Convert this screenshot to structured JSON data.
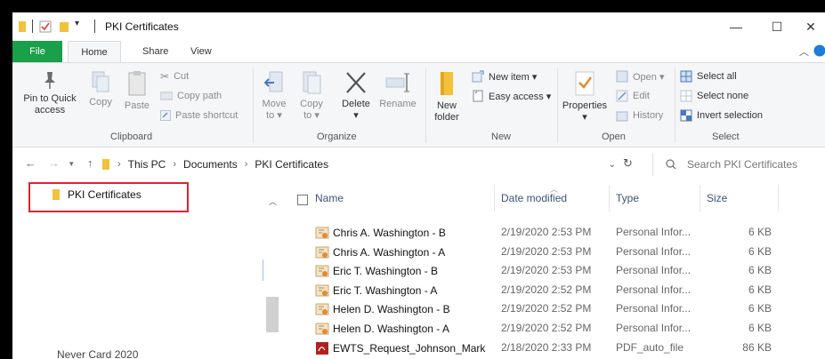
{
  "window": {
    "title": "PKI Certificates",
    "controls": {
      "minimize": "—",
      "maximize": "☐",
      "close": "✕"
    }
  },
  "tabs": [
    {
      "label": "File"
    },
    {
      "label": "Home"
    },
    {
      "label": "Share"
    },
    {
      "label": "View"
    }
  ],
  "ribbon": {
    "clipboard": {
      "pin_label_1": "Pin to Quick",
      "pin_label_2": "access",
      "copy": "Copy",
      "paste": "Paste",
      "cut": "Cut",
      "copy_path": "Copy path",
      "paste_shortcut": "Paste shortcut",
      "group": "Clipboard"
    },
    "organize": {
      "move_to_1": "Move",
      "move_to_2": "to ▾",
      "copy_to_1": "Copy",
      "copy_to_2": "to ▾",
      "delete_1": "Delete",
      "delete_2": "▾",
      "rename": "Rename",
      "group": "Organize"
    },
    "new": {
      "new_folder_1": "New",
      "new_folder_2": "folder",
      "new_item": "New item ▾",
      "easy_access": "Easy access ▾",
      "group": "New"
    },
    "open": {
      "properties_1": "Properties",
      "properties_2": "▾",
      "open": "Open ▾",
      "edit": "Edit",
      "history": "History",
      "group": "Open"
    },
    "select": {
      "select_all": "Select all",
      "select_none": "Select none",
      "invert_selection": "Invert selection",
      "group": "Select"
    }
  },
  "address": {
    "crumbs": [
      "This PC",
      "Documents",
      "PKI Certificates"
    ],
    "search_placeholder": "Search PKI Certificates"
  },
  "nav": {
    "selected_item": "PKI Certificates",
    "bottom_item": "Never Card 2020"
  },
  "columns": {
    "name": "Name",
    "date": "Date modified",
    "type": "Type",
    "size": "Size"
  },
  "files": [
    {
      "name": "Chris A. Washington - B",
      "date": "2/19/2020 2:53 PM",
      "type": "Personal Infor...",
      "size": "6 KB",
      "icon": "certificate-icon"
    },
    {
      "name": "Chris A. Washington - A",
      "date": "2/19/2020 2:53 PM",
      "type": "Personal Infor...",
      "size": "6 KB",
      "icon": "certificate-icon"
    },
    {
      "name": "Eric T. Washington - B",
      "date": "2/19/2020 2:53 PM",
      "type": "Personal Infor...",
      "size": "6 KB",
      "icon": "certificate-icon"
    },
    {
      "name": "Eric T. Washington - A",
      "date": "2/19/2020 2:52 PM",
      "type": "Personal Infor...",
      "size": "6 KB",
      "icon": "certificate-icon"
    },
    {
      "name": "Helen D. Washington - B",
      "date": "2/19/2020 2:52 PM",
      "type": "Personal Infor...",
      "size": "6 KB",
      "icon": "certificate-icon"
    },
    {
      "name": "Helen D. Washington - A",
      "date": "2/19/2020 2:52 PM",
      "type": "Personal Infor...",
      "size": "6 KB",
      "icon": "certificate-icon"
    },
    {
      "name": "EWTS_Request_Johnson_Mark",
      "date": "2/18/2020 2:33 PM",
      "type": "PDF_auto_file",
      "size": "86 KB",
      "icon": "pdf-icon"
    }
  ],
  "colors": {
    "file_tab": "#19a048",
    "selection_outline": "#e0232a",
    "folder": "#f3c13a",
    "header_text": "#3b5378"
  }
}
